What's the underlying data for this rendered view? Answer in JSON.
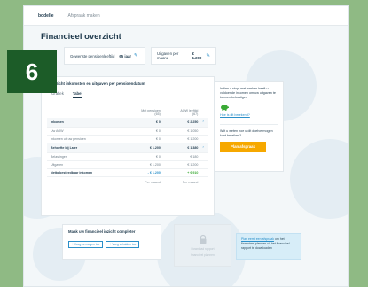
{
  "nav": {
    "brand": "bodelle",
    "link": "Afspraak maken"
  },
  "step_badge": "6",
  "page_title": "Financieel overzicht",
  "chips": [
    {
      "label": "Gewenste pensioenleeftijd",
      "value": "65 jaar"
    },
    {
      "label": "Uitgaven per maand",
      "value": "€ 1.200"
    }
  ],
  "card": {
    "title": "Overzicht inkomsten en uitgaven per pensioendatum",
    "tabs": [
      "Grafiek",
      "Tabel"
    ],
    "active_tab": "Tabel",
    "columns": [
      "Met pensioen",
      "AOW leeftijd"
    ],
    "column_sub": [
      "(65)",
      "(67)"
    ],
    "rows": [
      {
        "label": "Inkomen",
        "v1": "€ 0",
        "v2": "€ 2.250",
        "arrow": "⌃",
        "kind": "group"
      },
      {
        "label": "Uw AOW",
        "v1": "€ 0",
        "v2": "€ 1.050",
        "kind": "sub"
      },
      {
        "label": "Inkomen uit uw pensioen",
        "v1": "€ 0",
        "v2": "€ 1.200",
        "kind": "sub"
      },
      {
        "label": "Behoefte bij Laier",
        "v1": "€ 1.200",
        "v2": "€ 1.380",
        "arrow": "⌃",
        "kind": "group"
      },
      {
        "label": "Belastingen",
        "v1": "€ 0",
        "v2": "€ 180",
        "kind": "sub"
      },
      {
        "label": "Uitgaven",
        "v1": "€ 1.200",
        "v2": "€ 1.200",
        "kind": "sub"
      },
      {
        "label": "Netto besteedbaar inkomen",
        "v1": "- € 1.200",
        "v2": "+ € 910",
        "kind": "bold"
      }
    ],
    "footer": [
      "Per maand",
      "Per maand"
    ]
  },
  "side": {
    "intro": "Indien u stopt met werken heeft u voldoende inkomen om uw uitgaven te kunnen bekostigen",
    "link1": "Hoe is dit berekend?",
    "question": "Wilt u weten hoe u dit doelvermogen kunt bereiken?",
    "cta": "Plan afspraak"
  },
  "complete": {
    "title": "Maak uw financieel inzicht completer",
    "btn1": "+ Voeg vermogen toe",
    "btn2": "+ Voeg schulden toe"
  },
  "locked": {
    "line1": "Download rapport",
    "line2": "financieel plannen"
  },
  "info": {
    "link": "Plan eerst een afspraak",
    "text": " om het financieel plannen uit het financieel rapport te downloaden"
  },
  "colors": {
    "accent": "#2a8fc9",
    "cta": "#f6a800",
    "positive": "#3aaa35",
    "badge": "#1c5c28"
  }
}
